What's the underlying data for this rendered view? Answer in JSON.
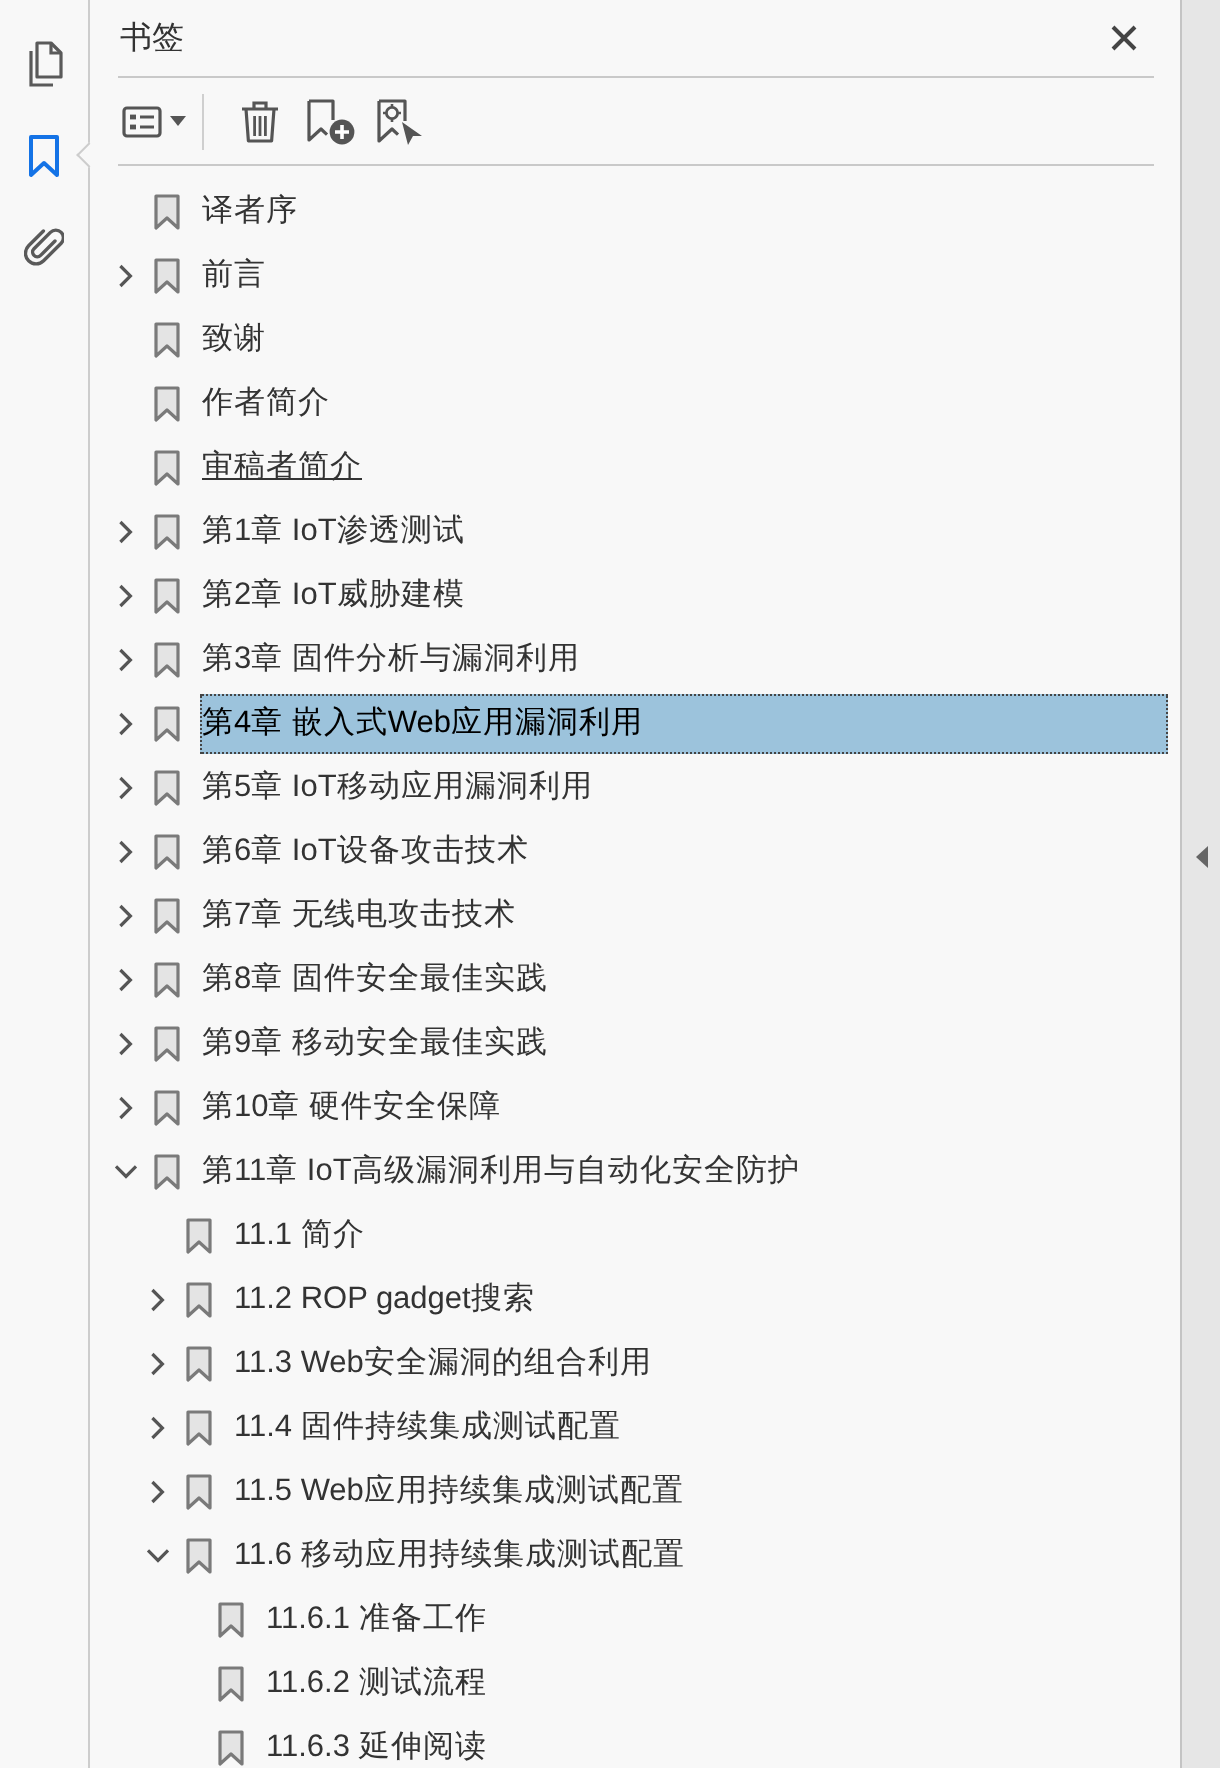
{
  "sidebar_tools": [
    {
      "kind": "pages",
      "selected": false
    },
    {
      "kind": "bookmarks",
      "selected": true
    },
    {
      "kind": "attachments",
      "selected": false
    }
  ],
  "bookmarks_panel": {
    "title": "书签",
    "toolbar": [
      {
        "kind": "options"
      },
      {
        "kind": "delete"
      },
      {
        "kind": "new-bookmark"
      },
      {
        "kind": "new-bookmark-from-selection"
      }
    ],
    "items": [
      {
        "label": "译者序",
        "expandable": false,
        "selected": false,
        "hovered": false
      },
      {
        "label": "前言",
        "expandable": true,
        "expanded": false,
        "selected": false,
        "hovered": false
      },
      {
        "label": "致谢",
        "expandable": false,
        "selected": false,
        "hovered": false
      },
      {
        "label": "作者简介",
        "expandable": false,
        "selected": false,
        "hovered": false
      },
      {
        "label": "审稿者简介",
        "expandable": false,
        "selected": false,
        "hovered": true
      },
      {
        "label": "第1章 IoT渗透测试",
        "expandable": true,
        "expanded": false,
        "selected": false,
        "hovered": false
      },
      {
        "label": "第2章 IoT威胁建模",
        "expandable": true,
        "expanded": false,
        "selected": false,
        "hovered": false
      },
      {
        "label": "第3章 固件分析与漏洞利用",
        "expandable": true,
        "expanded": false,
        "selected": false,
        "hovered": false
      },
      {
        "label": "第4章 嵌入式Web应用漏洞利用",
        "expandable": true,
        "expanded": false,
        "selected": true,
        "hovered": false
      },
      {
        "label": "第5章 IoT移动应用漏洞利用",
        "expandable": true,
        "expanded": false,
        "selected": false,
        "hovered": false
      },
      {
        "label": "第6章 IoT设备攻击技术",
        "expandable": true,
        "expanded": false,
        "selected": false,
        "hovered": false
      },
      {
        "label": "第7章 无线电攻击技术",
        "expandable": true,
        "expanded": false,
        "selected": false,
        "hovered": false
      },
      {
        "label": "第8章 固件安全最佳实践",
        "expandable": true,
        "expanded": false,
        "selected": false,
        "hovered": false
      },
      {
        "label": "第9章 移动安全最佳实践",
        "expandable": true,
        "expanded": false,
        "selected": false,
        "hovered": false
      },
      {
        "label": "第10章 硬件安全保障",
        "expandable": true,
        "expanded": false,
        "selected": false,
        "hovered": false
      },
      {
        "label": "第11章 IoT高级漏洞利用与自动化安全防护",
        "expandable": true,
        "expanded": true,
        "selected": false,
        "hovered": false,
        "children": [
          {
            "label": "11.1 简介",
            "expandable": false,
            "selected": false,
            "hovered": false
          },
          {
            "label": "11.2 ROP gadget搜索",
            "expandable": true,
            "expanded": false,
            "selected": false,
            "hovered": false
          },
          {
            "label": "11.3 Web安全漏洞的组合利用",
            "expandable": true,
            "expanded": false,
            "selected": false,
            "hovered": false
          },
          {
            "label": "11.4 固件持续集成测试配置",
            "expandable": true,
            "expanded": false,
            "selected": false,
            "hovered": false
          },
          {
            "label": "11.5 Web应用持续集成测试配置",
            "expandable": true,
            "expanded": false,
            "selected": false,
            "hovered": false
          },
          {
            "label": "11.6 移动应用持续集成测试配置",
            "expandable": true,
            "expanded": true,
            "selected": false,
            "hovered": false,
            "children": [
              {
                "label": "11.6.1 准备工作",
                "expandable": false,
                "selected": false,
                "hovered": false
              },
              {
                "label": "11.6.2 测试流程",
                "expandable": false,
                "selected": false,
                "hovered": false
              },
              {
                "label": "11.6.3 延伸阅读",
                "expandable": false,
                "selected": false,
                "hovered": false
              }
            ]
          }
        ]
      }
    ]
  }
}
